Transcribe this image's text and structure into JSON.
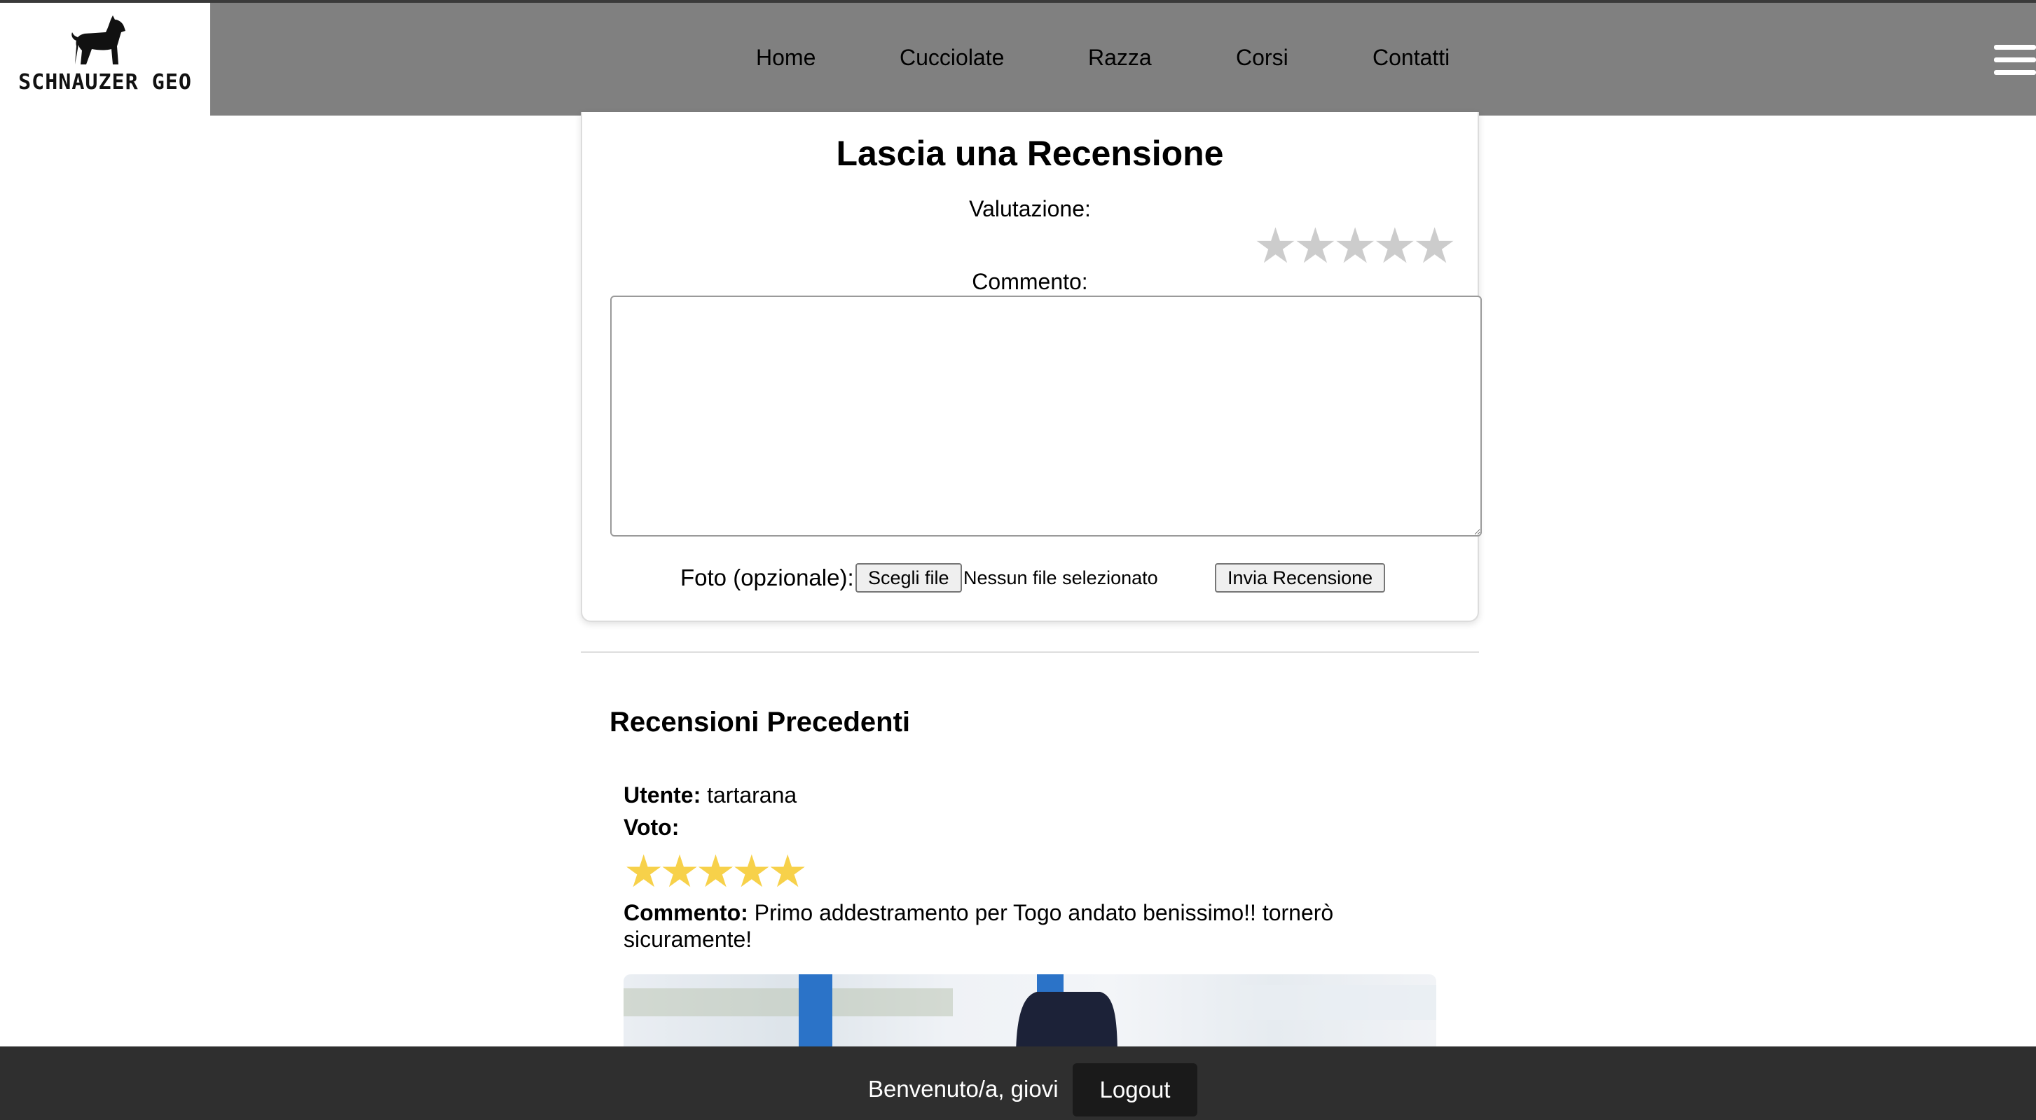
{
  "brand": {
    "name": "SCHNAUZER GEO",
    "logo_icon": "schnauzer-dog-icon"
  },
  "nav": {
    "items": [
      {
        "label": "Home"
      },
      {
        "label": "Cucciolate"
      },
      {
        "label": "Razza"
      },
      {
        "label": "Corsi"
      },
      {
        "label": "Contatti"
      }
    ],
    "menu_icon": "hamburger-menu-icon"
  },
  "review_form": {
    "title": "Lascia una Recensione",
    "rating_label": "Valutazione:",
    "rating_value": 0,
    "rating_max": 5,
    "comment_label": "Commento:",
    "comment_value": "",
    "photo_label": "Foto (opzionale):",
    "file_button": "Scegli file",
    "file_status": "Nessun file selezionato",
    "submit": "Invia Recensione"
  },
  "reviews": {
    "heading": "Recensioni Precedenti",
    "items": [
      {
        "user_label": "Utente:",
        "user": "tartarana",
        "vote_label": "Voto:",
        "rating": 5,
        "comment_label": "Commento:",
        "comment": "Primo addestramento per Togo andato benissimo!! tornerò sicuramente!"
      }
    ]
  },
  "footer": {
    "welcome": "Benvenuto/a, giovi",
    "logout": "Logout"
  },
  "colors": {
    "header_bg": "#808080",
    "footer_bg": "#2f2f2f",
    "star_filled": "#f7d14a",
    "star_empty": "#cccccc"
  }
}
